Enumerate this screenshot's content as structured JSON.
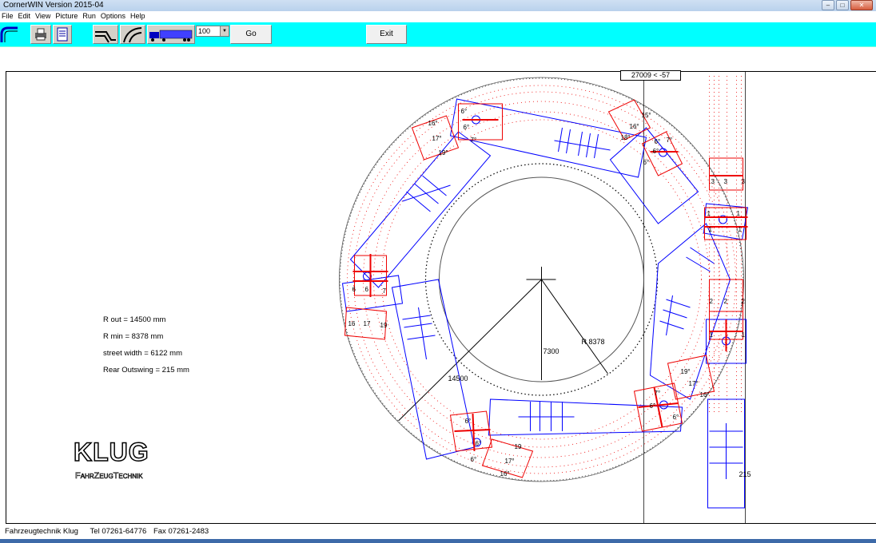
{
  "window": {
    "title": "CornerWIN  Version 2015-04"
  },
  "menu": [
    "File",
    "Edit",
    "View",
    "Picture",
    "Run",
    "Options",
    "Help"
  ],
  "toolbar": {
    "zoom_value": "100",
    "go_label": "Go",
    "exit_label": "Exit",
    "icons": [
      "curve-icon",
      "print-icon",
      "document-icon",
      "corner-road-icon",
      "curved-road-icon",
      "truck-trailer-icon"
    ]
  },
  "drawing": {
    "position_label": "27009 < -57",
    "dim_outer": "14500",
    "dim_mid": "7300",
    "dim_inner": "R 8378",
    "outswing_label": "215",
    "colors": {
      "vehicle": "#0000ff",
      "wheels": "#ff0000",
      "guide": "#000000"
    }
  },
  "info": {
    "r_out": "R out =  14500 mm",
    "r_min": "R min = 8378 mm",
    "street_width": "street width  = 6122 mm",
    "rear_outswing": "Rear Outswing = 215 mm"
  },
  "logo": {
    "line1": "KLUG",
    "line2": "FahrZeugTechnik"
  },
  "footer": {
    "company": "Fahrzeugtechnik Klug",
    "tel": "Tel 07261-64776",
    "fax": "Fax 07261-2483"
  }
}
